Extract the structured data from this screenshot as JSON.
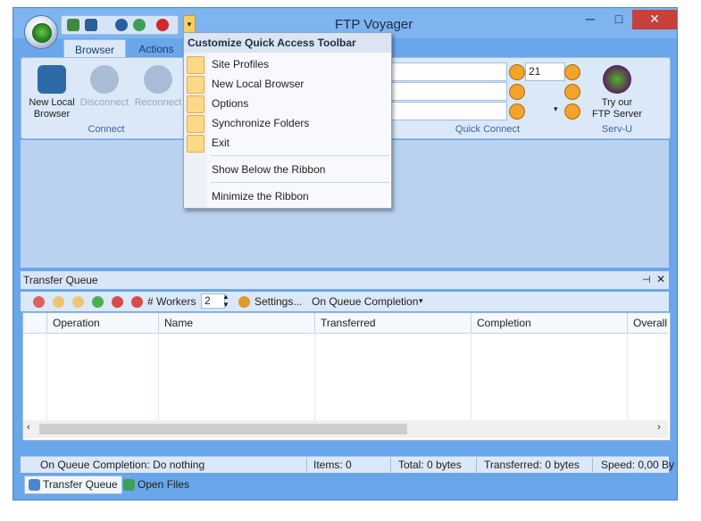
{
  "window": {
    "title": "FTP Voyager",
    "controls": {
      "minimize": "─",
      "maximize": "□",
      "close": "✕"
    }
  },
  "qat": {
    "dropdown_glyph": "▾"
  },
  "ribbon": {
    "tabs": [
      "Browser",
      "Actions"
    ],
    "connect_group": {
      "label": "Connect",
      "buttons": [
        {
          "label": "New Local\nBrowser",
          "enabled": true
        },
        {
          "label": "Disconnect",
          "enabled": false
        },
        {
          "label": "Reconnect",
          "enabled": false
        }
      ]
    },
    "quick_connect": {
      "label": "Quick Connect",
      "port_value": "21"
    },
    "servu": {
      "label": "Serv-U",
      "button_label": "Try our\nFTP Server"
    }
  },
  "transfer_queue": {
    "title": "Transfer Queue",
    "header_controls": {
      "pin": "⊣",
      "close": "✕"
    },
    "workers_label": "# Workers",
    "workers_value": "2",
    "settings_label": "Settings...",
    "on_completion_label": "On Queue Completion",
    "columns": [
      "Operation",
      "Name",
      "Transferred",
      "Completion",
      "Overall"
    ]
  },
  "statusbar": {
    "on_completion": "On Queue Completion: Do nothing",
    "items": "Items: 0",
    "total": "Total: 0 bytes",
    "transferred": "Transferred: 0 bytes",
    "speed": "Speed: 0,00 By"
  },
  "bottom_tabs": [
    "Transfer Queue",
    "Open Files"
  ],
  "menu": {
    "header": "Customize Quick Access Toolbar",
    "checked_items": [
      "Site Profiles",
      "New Local Browser",
      "Options",
      "Synchronize Folders",
      "Exit"
    ],
    "extra_items": [
      "Show Below the Ribbon",
      "Minimize the Ribbon"
    ]
  },
  "colors": {
    "accent": "#6aa6ea",
    "close": "#c7403a",
    "menu_check": "#fcd987"
  }
}
